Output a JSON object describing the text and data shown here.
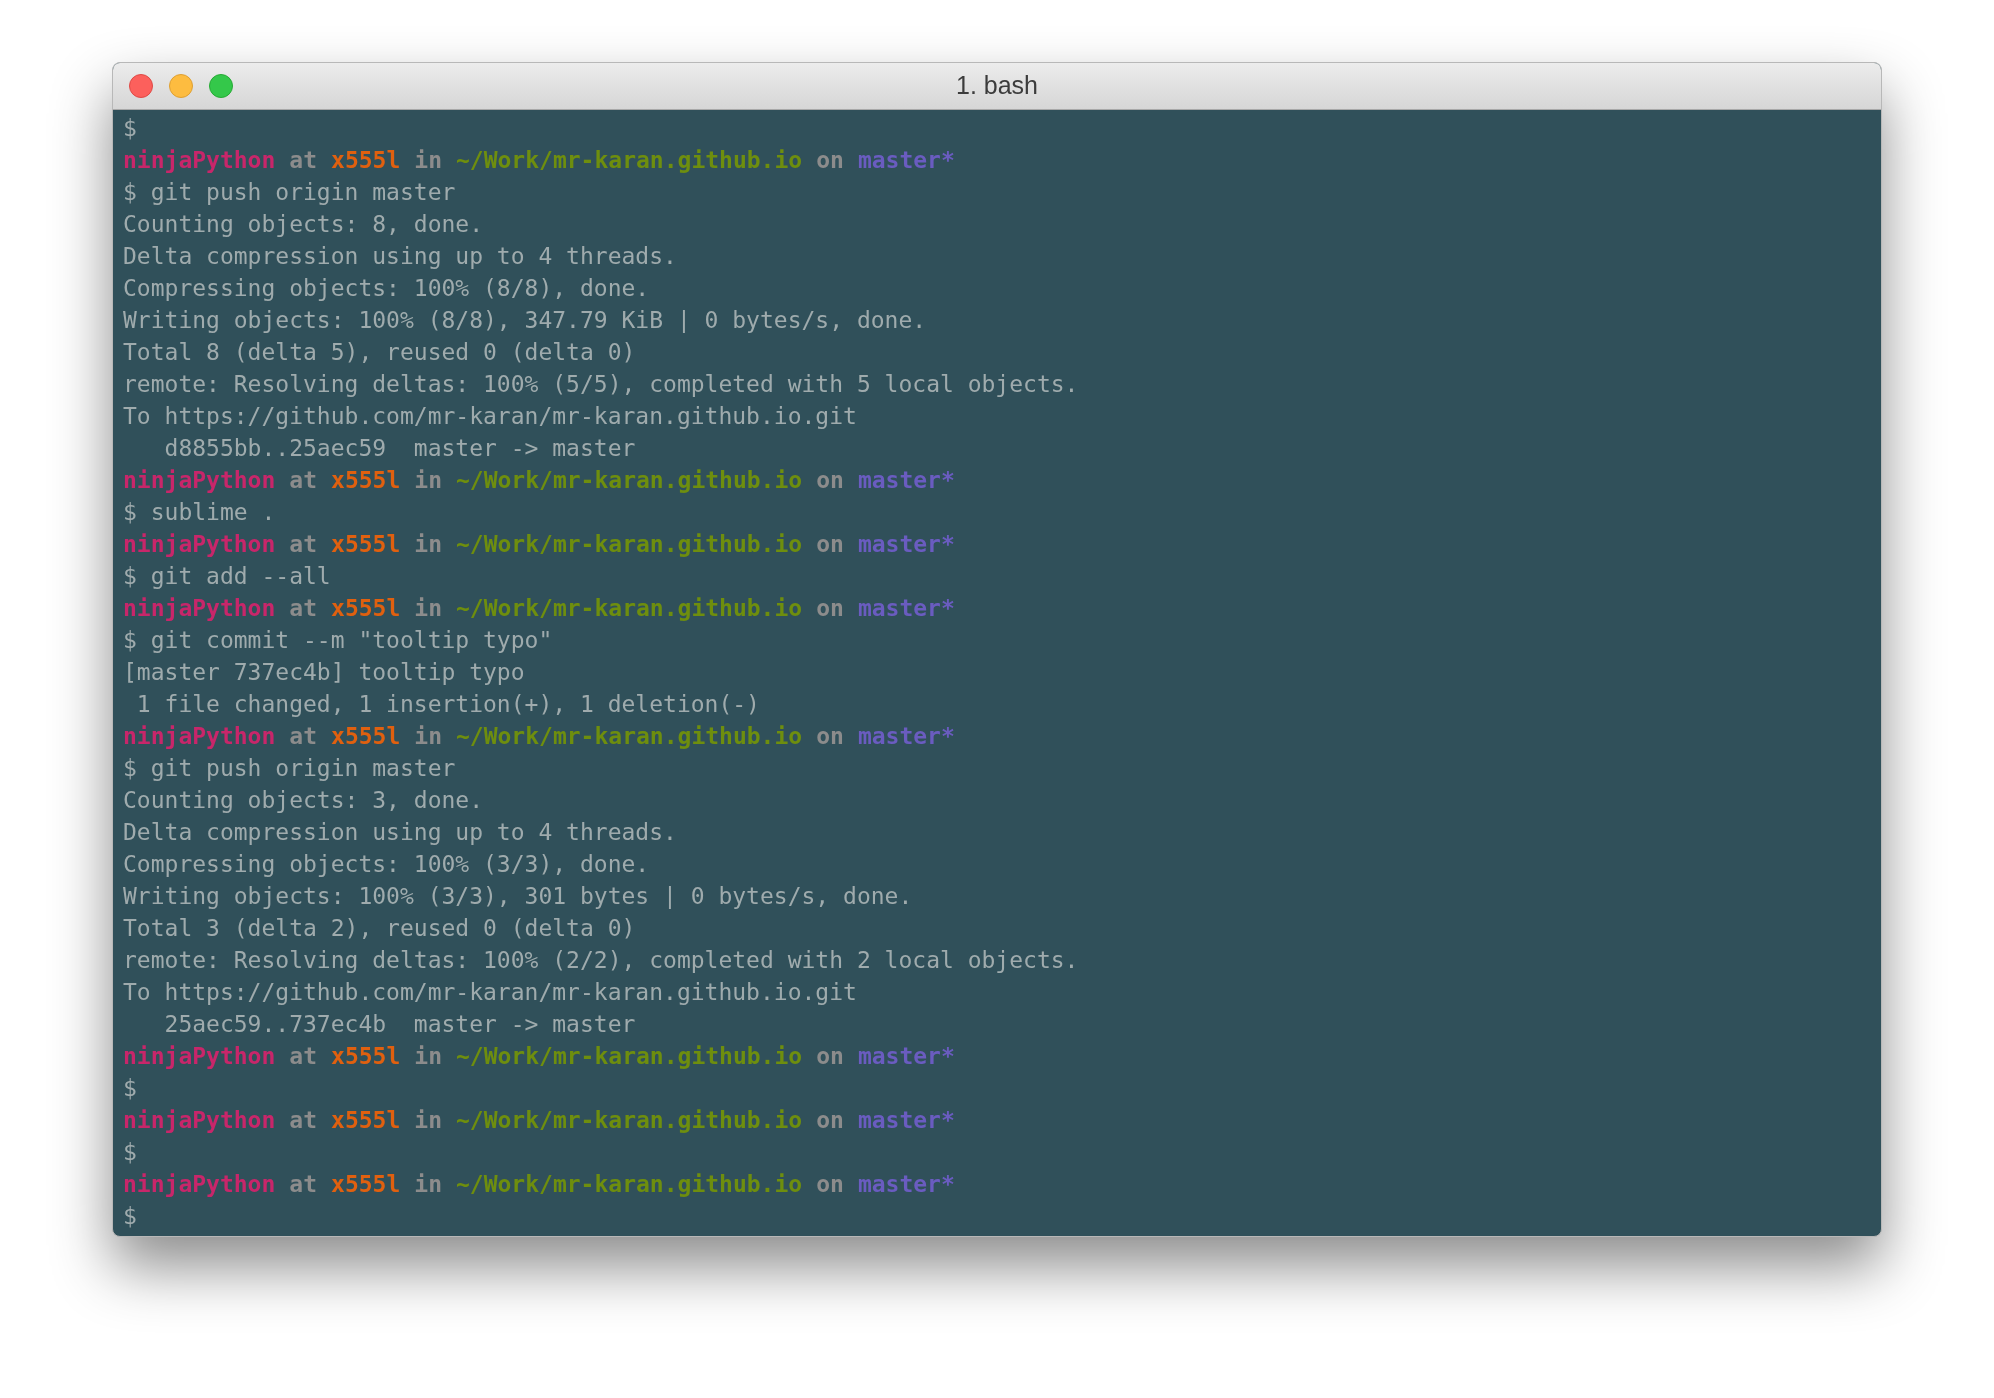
{
  "window": {
    "title": "1. bash"
  },
  "lines": [
    {
      "kind": "text",
      "text": "$"
    },
    {
      "kind": "prompt",
      "parts": [
        {
          "text": "ninjaPython",
          "color": "#c8266a"
        },
        {
          "text": "at",
          "color": "#8c8c8c"
        },
        {
          "text": "x555l",
          "color": "#e0600f"
        },
        {
          "text": "in",
          "color": "#8c8c8c"
        },
        {
          "text": "~/Work/mr-karan.github.io",
          "color": "#6e8e0e"
        },
        {
          "text": "on",
          "color": "#8c8c8c"
        },
        {
          "text": "master*",
          "color": "#6a5cc0"
        }
      ]
    },
    {
      "kind": "text",
      "text": "$ git push origin master"
    },
    {
      "kind": "text",
      "text": "Counting objects: 8, done."
    },
    {
      "kind": "text",
      "text": "Delta compression using up to 4 threads."
    },
    {
      "kind": "text",
      "text": "Compressing objects: 100% (8/8), done."
    },
    {
      "kind": "text",
      "text": "Writing objects: 100% (8/8), 347.79 KiB | 0 bytes/s, done."
    },
    {
      "kind": "text",
      "text": "Total 8 (delta 5), reused 0 (delta 0)"
    },
    {
      "kind": "text",
      "text": "remote: Resolving deltas: 100% (5/5), completed with 5 local objects."
    },
    {
      "kind": "text",
      "text": "To https://github.com/mr-karan/mr-karan.github.io.git"
    },
    {
      "kind": "text",
      "text": "   d8855bb..25aec59  master -> master"
    },
    {
      "kind": "prompt",
      "parts": [
        {
          "text": "ninjaPython",
          "color": "#c8266a"
        },
        {
          "text": "at",
          "color": "#8c8c8c"
        },
        {
          "text": "x555l",
          "color": "#e0600f"
        },
        {
          "text": "in",
          "color": "#8c8c8c"
        },
        {
          "text": "~/Work/mr-karan.github.io",
          "color": "#6e8e0e"
        },
        {
          "text": "on",
          "color": "#8c8c8c"
        },
        {
          "text": "master*",
          "color": "#6a5cc0"
        }
      ]
    },
    {
      "kind": "text",
      "text": "$ sublime ."
    },
    {
      "kind": "prompt",
      "parts": [
        {
          "text": "ninjaPython",
          "color": "#c8266a"
        },
        {
          "text": "at",
          "color": "#8c8c8c"
        },
        {
          "text": "x555l",
          "color": "#e0600f"
        },
        {
          "text": "in",
          "color": "#8c8c8c"
        },
        {
          "text": "~/Work/mr-karan.github.io",
          "color": "#6e8e0e"
        },
        {
          "text": "on",
          "color": "#8c8c8c"
        },
        {
          "text": "master*",
          "color": "#6a5cc0"
        }
      ]
    },
    {
      "kind": "text",
      "text": "$ git add --all"
    },
    {
      "kind": "prompt",
      "parts": [
        {
          "text": "ninjaPython",
          "color": "#c8266a"
        },
        {
          "text": "at",
          "color": "#8c8c8c"
        },
        {
          "text": "x555l",
          "color": "#e0600f"
        },
        {
          "text": "in",
          "color": "#8c8c8c"
        },
        {
          "text": "~/Work/mr-karan.github.io",
          "color": "#6e8e0e"
        },
        {
          "text": "on",
          "color": "#8c8c8c"
        },
        {
          "text": "master*",
          "color": "#6a5cc0"
        }
      ]
    },
    {
      "kind": "text",
      "text": "$ git commit --m \"tooltip typo\""
    },
    {
      "kind": "text",
      "text": "[master 737ec4b] tooltip typo"
    },
    {
      "kind": "text",
      "text": " 1 file changed, 1 insertion(+), 1 deletion(-)"
    },
    {
      "kind": "prompt",
      "parts": [
        {
          "text": "ninjaPython",
          "color": "#c8266a"
        },
        {
          "text": "at",
          "color": "#8c8c8c"
        },
        {
          "text": "x555l",
          "color": "#e0600f"
        },
        {
          "text": "in",
          "color": "#8c8c8c"
        },
        {
          "text": "~/Work/mr-karan.github.io",
          "color": "#6e8e0e"
        },
        {
          "text": "on",
          "color": "#8c8c8c"
        },
        {
          "text": "master*",
          "color": "#6a5cc0"
        }
      ]
    },
    {
      "kind": "text",
      "text": "$ git push origin master"
    },
    {
      "kind": "text",
      "text": "Counting objects: 3, done."
    },
    {
      "kind": "text",
      "text": "Delta compression using up to 4 threads."
    },
    {
      "kind": "text",
      "text": "Compressing objects: 100% (3/3), done."
    },
    {
      "kind": "text",
      "text": "Writing objects: 100% (3/3), 301 bytes | 0 bytes/s, done."
    },
    {
      "kind": "text",
      "text": "Total 3 (delta 2), reused 0 (delta 0)"
    },
    {
      "kind": "text",
      "text": "remote: Resolving deltas: 100% (2/2), completed with 2 local objects."
    },
    {
      "kind": "text",
      "text": "To https://github.com/mr-karan/mr-karan.github.io.git"
    },
    {
      "kind": "text",
      "text": "   25aec59..737ec4b  master -> master"
    },
    {
      "kind": "prompt",
      "parts": [
        {
          "text": "ninjaPython",
          "color": "#c8266a"
        },
        {
          "text": "at",
          "color": "#8c8c8c"
        },
        {
          "text": "x555l",
          "color": "#e0600f"
        },
        {
          "text": "in",
          "color": "#8c8c8c"
        },
        {
          "text": "~/Work/mr-karan.github.io",
          "color": "#6e8e0e"
        },
        {
          "text": "on",
          "color": "#8c8c8c"
        },
        {
          "text": "master*",
          "color": "#6a5cc0"
        }
      ]
    },
    {
      "kind": "text",
      "text": "$"
    },
    {
      "kind": "prompt",
      "parts": [
        {
          "text": "ninjaPython",
          "color": "#c8266a"
        },
        {
          "text": "at",
          "color": "#8c8c8c"
        },
        {
          "text": "x555l",
          "color": "#e0600f"
        },
        {
          "text": "in",
          "color": "#8c8c8c"
        },
        {
          "text": "~/Work/mr-karan.github.io",
          "color": "#6e8e0e"
        },
        {
          "text": "on",
          "color": "#8c8c8c"
        },
        {
          "text": "master*",
          "color": "#6a5cc0"
        }
      ]
    },
    {
      "kind": "text",
      "text": "$"
    },
    {
      "kind": "prompt",
      "parts": [
        {
          "text": "ninjaPython",
          "color": "#c8266a"
        },
        {
          "text": "at",
          "color": "#8c8c8c"
        },
        {
          "text": "x555l",
          "color": "#e0600f"
        },
        {
          "text": "in",
          "color": "#8c8c8c"
        },
        {
          "text": "~/Work/mr-karan.github.io",
          "color": "#6e8e0e"
        },
        {
          "text": "on",
          "color": "#8c8c8c"
        },
        {
          "text": "master*",
          "color": "#6a5cc0"
        }
      ]
    },
    {
      "kind": "text",
      "text": "$"
    }
  ]
}
